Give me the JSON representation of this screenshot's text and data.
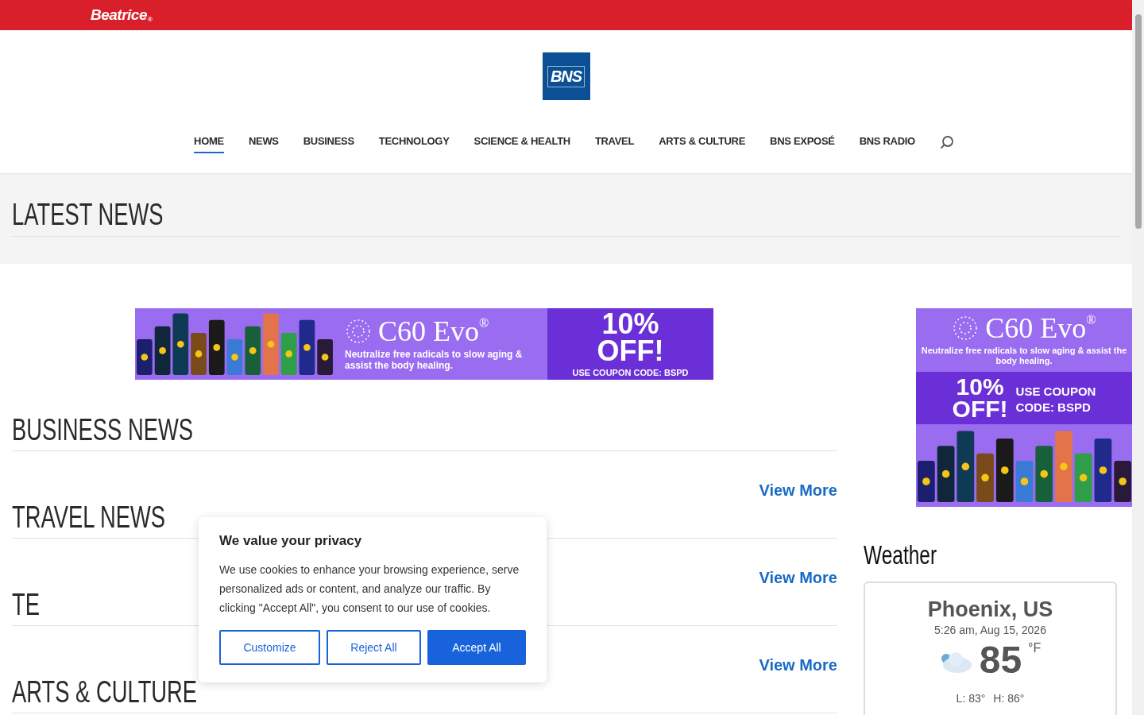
{
  "top_bar": {
    "brand": "Beatrice",
    "brand_mark": "®"
  },
  "logo": {
    "text": "BNS"
  },
  "nav": {
    "items": [
      {
        "label": "HOME",
        "selected": true
      },
      {
        "label": "NEWS",
        "selected": false
      },
      {
        "label": "BUSINESS",
        "selected": false
      },
      {
        "label": "TECHNOLOGY",
        "selected": false
      },
      {
        "label": "SCIENCE & HEALTH",
        "selected": false
      },
      {
        "label": "TRAVEL",
        "selected": false
      },
      {
        "label": "ARTS & CULTURE",
        "selected": false
      },
      {
        "label": "BNS EXPOSÉ",
        "selected": false
      },
      {
        "label": "BNS RADIO",
        "selected": false
      }
    ]
  },
  "page_title": "LATEST NEWS",
  "banner_ad": {
    "brand": "C60 Evo",
    "registered": "®",
    "tagline": "Neutralize free radicals to slow aging & assist the body healing.",
    "offer": [
      "10%",
      "OFF!"
    ],
    "coupon": "USE COUPON CODE: BSPD"
  },
  "sections": [
    {
      "title": "BUSINESS NEWS",
      "link": "View More"
    },
    {
      "title": "TRAVEL NEWS",
      "link": "View More"
    },
    {
      "title": "TE",
      "link": "View More"
    },
    {
      "title": "ARTS & CULTURE"
    }
  ],
  "side_ad": {
    "brand": "C60 Evo",
    "registered": "®",
    "tagline": "Neutralize free radicals to slow aging & assist the body healing.",
    "offer": [
      "10%",
      "OFF!"
    ],
    "coupon": [
      "USE COUPON",
      "CODE: BSPD"
    ]
  },
  "weather": {
    "heading": "Weather",
    "location": "Phoenix, US",
    "datetime": "5:26 am, Aug 15, 2026",
    "temperature": "85",
    "unit": "°F",
    "low": "L: 83°",
    "high": "H: 86°"
  },
  "cookie_dialog": {
    "title": "We value your privacy",
    "text": "We use cookies to enhance your browsing experience, serve personalized ads or content, and analyze our traffic. By clicking \"Accept All\", you consent to our use of cookies.",
    "buttons": [
      {
        "label": "Customize",
        "kind": "outline"
      },
      {
        "label": "Reject All",
        "kind": "outline"
      },
      {
        "label": "Accept All",
        "kind": "primary"
      }
    ]
  }
}
